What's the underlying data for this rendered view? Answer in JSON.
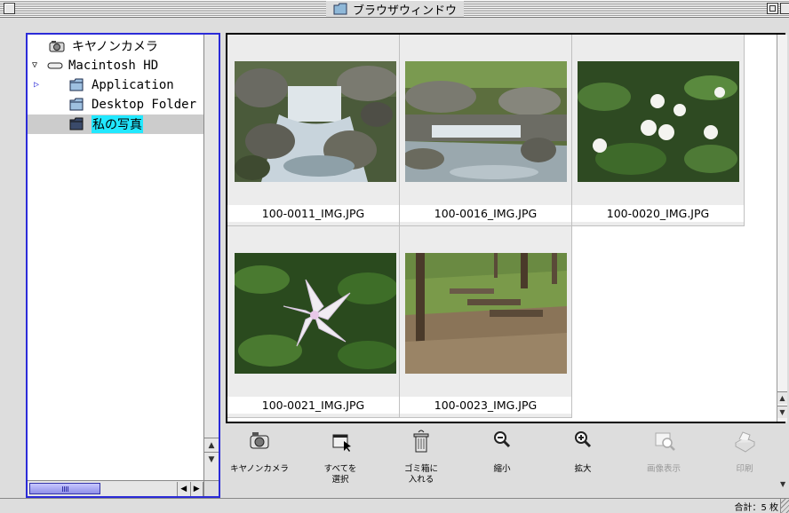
{
  "window": {
    "title": "ブラウザウィンドウ"
  },
  "sidebar": {
    "items": [
      {
        "label": "キヤノンカメラ",
        "icon": "canon-camera-icon"
      },
      {
        "label": "Macintosh HD",
        "icon": "hard-drive-icon",
        "expanded": true
      },
      {
        "label": "Application",
        "icon": "folder-icon",
        "collapsed": true
      },
      {
        "label": "Desktop Folder",
        "icon": "folder-icon"
      },
      {
        "label": "私の写真",
        "icon": "folder-icon",
        "selected": true
      }
    ]
  },
  "thumbnails": [
    {
      "filename": "100-0011_IMG.JPG",
      "scene": "waterfall"
    },
    {
      "filename": "100-0016_IMG.JPG",
      "scene": "stream"
    },
    {
      "filename": "100-0020_IMG.JPG",
      "scene": "white-flowers"
    },
    {
      "filename": "100-0021_IMG.JPG",
      "scene": "lily"
    },
    {
      "filename": "100-0023_IMG.JPG",
      "scene": "park-benches"
    }
  ],
  "toolbar": {
    "items": [
      {
        "label": "キヤノンカメラ",
        "icon": "canon-camera-icon",
        "enabled": true
      },
      {
        "label": "すべてを\n選択",
        "icon": "select-all-icon",
        "enabled": true
      },
      {
        "label": "ゴミ箱に\n入れる",
        "icon": "trash-icon",
        "enabled": true
      },
      {
        "label": "縮小",
        "icon": "zoom-out-icon",
        "enabled": true
      },
      {
        "label": "拡大",
        "icon": "zoom-in-icon",
        "enabled": true
      },
      {
        "label": "画像表示",
        "icon": "view-image-icon",
        "enabled": false
      },
      {
        "label": "印刷",
        "icon": "print-icon",
        "enabled": false
      }
    ]
  },
  "status": {
    "total": "合計：5 枚"
  },
  "colors": {
    "selection_highlight": "#22e8ff",
    "focus_border": "#2b2bd8",
    "window_bg": "#dddddd"
  }
}
